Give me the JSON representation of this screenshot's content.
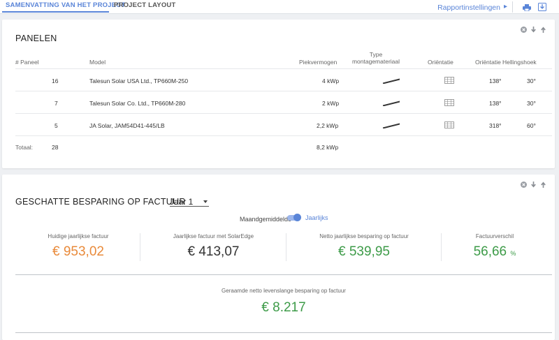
{
  "tabs": [
    {
      "label": "SAMENVATTING VAN HET PROJECT",
      "active": true
    },
    {
      "label": "PROJECT LAYOUT",
      "active": false
    }
  ],
  "toolbar": {
    "report_settings": "Rapportinstellingen",
    "icons": [
      "print-icon",
      "download-icon"
    ]
  },
  "colors": {
    "accent": "#5a85d8",
    "orange": "#e98a3a",
    "green": "#3d9b48"
  },
  "panels": {
    "title": "PANELEN",
    "columns": [
      "# Paneel",
      "Model",
      "Piekvermogen",
      "Type montagemateriaal",
      "Oriëntatie",
      "Oriëntatie",
      "Hellingshoek"
    ],
    "rows": [
      {
        "count": "16",
        "model": "Talesun Solar USA Ltd., TP660M-250",
        "peak": "4 kWp",
        "orientation_deg": "138°",
        "tilt": "30°"
      },
      {
        "count": "7",
        "model": "Talesun Solar Co. Ltd., TP660M-280",
        "peak": "2 kWp",
        "orientation_deg": "138°",
        "tilt": "30°"
      },
      {
        "count": "5",
        "model": "JA Solar, JAM54D41-445/LB",
        "peak": "2,2 kWp",
        "orientation_deg": "318°",
        "tilt": "60°"
      }
    ],
    "total": {
      "label": "Totaal:",
      "count": "28",
      "peak": "8,2 kWp"
    }
  },
  "savings": {
    "title": "GESCHATTE BESPARING OP FACTUUR",
    "year": "Jaar 1",
    "toggle_left": "Maandgemiddelde",
    "toggle_right": "Jaarlijks",
    "toggle_on": true,
    "metrics": [
      {
        "label": "Huidige jaarlijkse factuur",
        "value": "€ 953,02"
      },
      {
        "label": "Jaarlijkse factuur met SolarEdge",
        "value": "€ 413,07"
      },
      {
        "label": "Netto jaarlijkse besparing op factuur",
        "value": "€ 539,95"
      },
      {
        "label": "Factuurverschil",
        "value": "56,66",
        "unit": "%"
      }
    ],
    "lifetime": {
      "label": "Geraamde netto levenslange besparing op factuur",
      "value": "€ 8.217"
    }
  }
}
